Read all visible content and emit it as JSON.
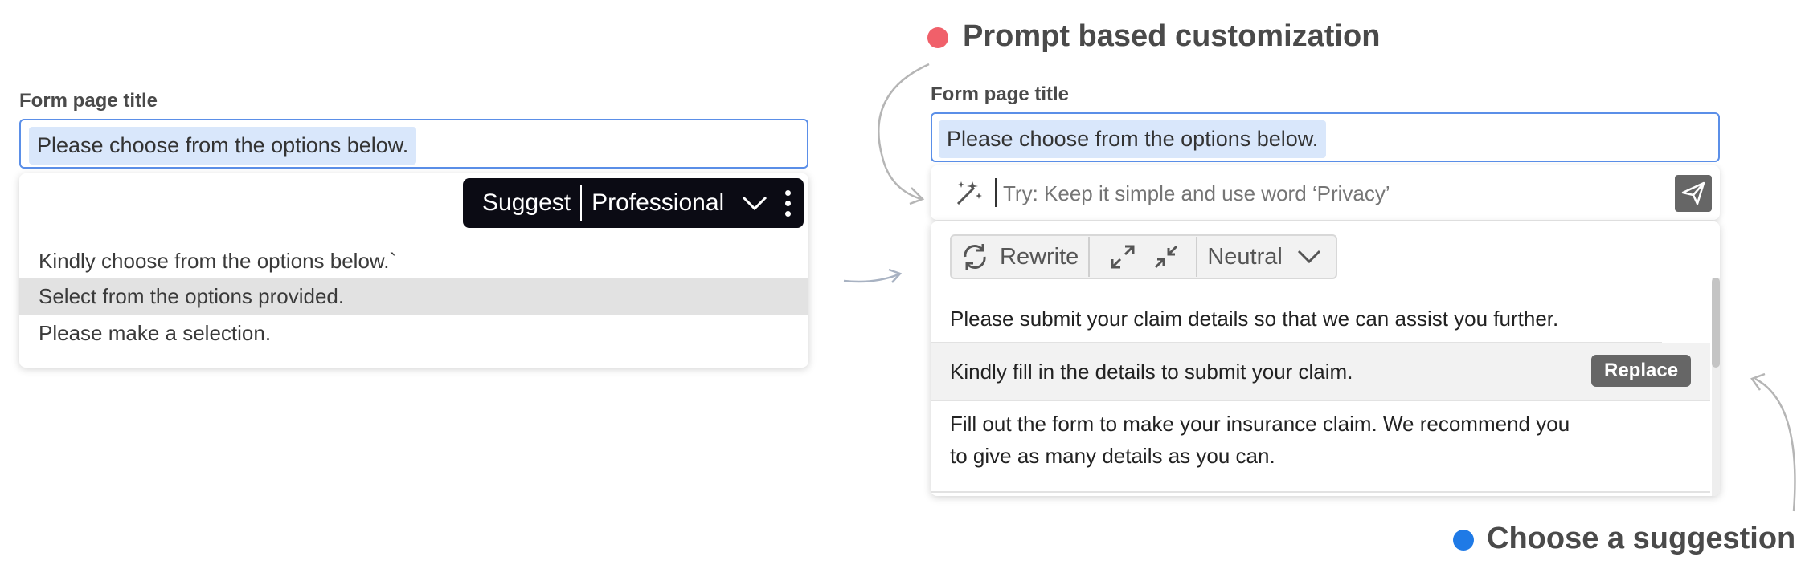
{
  "left": {
    "field_label": "Form page title",
    "input_value": "Please choose from the options below.",
    "toolbar": {
      "suggest_label": "Suggest",
      "tone_value": "Professional"
    },
    "options": [
      "Kindly choose from the options below.`",
      "Select from the options provided.",
      "Please make a selection."
    ],
    "highlighted_option_index": 1
  },
  "right": {
    "legend_top": {
      "label": "Prompt based customization",
      "color": "#f0606a"
    },
    "legend_bottom": {
      "label": "Choose a suggestion",
      "color": "#1f7ae6"
    },
    "field_label": "Form page title",
    "input_value": "Please choose from the options below.",
    "prompt_placeholder": "Try: Keep it simple and use word ‘Privacy’",
    "tools": {
      "rewrite_label": "Rewrite",
      "tone_value": "Neutral"
    },
    "suggestions": [
      "Please submit your claim details so that we can assist you further.",
      "Kindly fill in the details to submit your claim.",
      "Fill out the form to make your insurance claim. We recommend you",
      "to give as many details as you can."
    ],
    "replace_label": "Replace"
  },
  "icons": {
    "chevron": "chevron-down-icon",
    "more": "more-vertical-icon",
    "magic": "magic-wand-icon",
    "send": "send-icon",
    "rewrite": "refresh-icon",
    "expand": "expand-icon",
    "shrink": "shrink-icon"
  }
}
